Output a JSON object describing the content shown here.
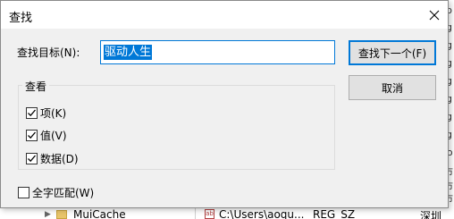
{
  "dialog": {
    "title": "查找",
    "find_label": "查找目标(N):",
    "find_value": "驱动人生",
    "find_next_button": "查找下一个(F)",
    "cancel_button": "取消",
    "look_at_group": "查看",
    "options": [
      {
        "label": "项(K)",
        "checked": true
      },
      {
        "label": "值(V)",
        "checked": true
      },
      {
        "label": "数据(D)",
        "checked": true
      }
    ],
    "match_whole": {
      "label": "全字匹配(W)",
      "checked": false
    }
  },
  "background": {
    "right_strip": [
      "ib",
      "ig",
      "ig",
      "ig",
      "ig",
      "ig",
      "ig",
      "ig",
      "fo",
      "市",
      "市",
      "市",
      "市"
    ],
    "tree_item": "MuiCache",
    "row_path": "C:\\Users\\aoqu...",
    "row_type": "REG_SZ",
    "row_data": "深圳"
  },
  "colors": {
    "accent": "#0078d7",
    "dialog_bg": "#f0f0f0",
    "button_bg": "#e1e1e1"
  }
}
